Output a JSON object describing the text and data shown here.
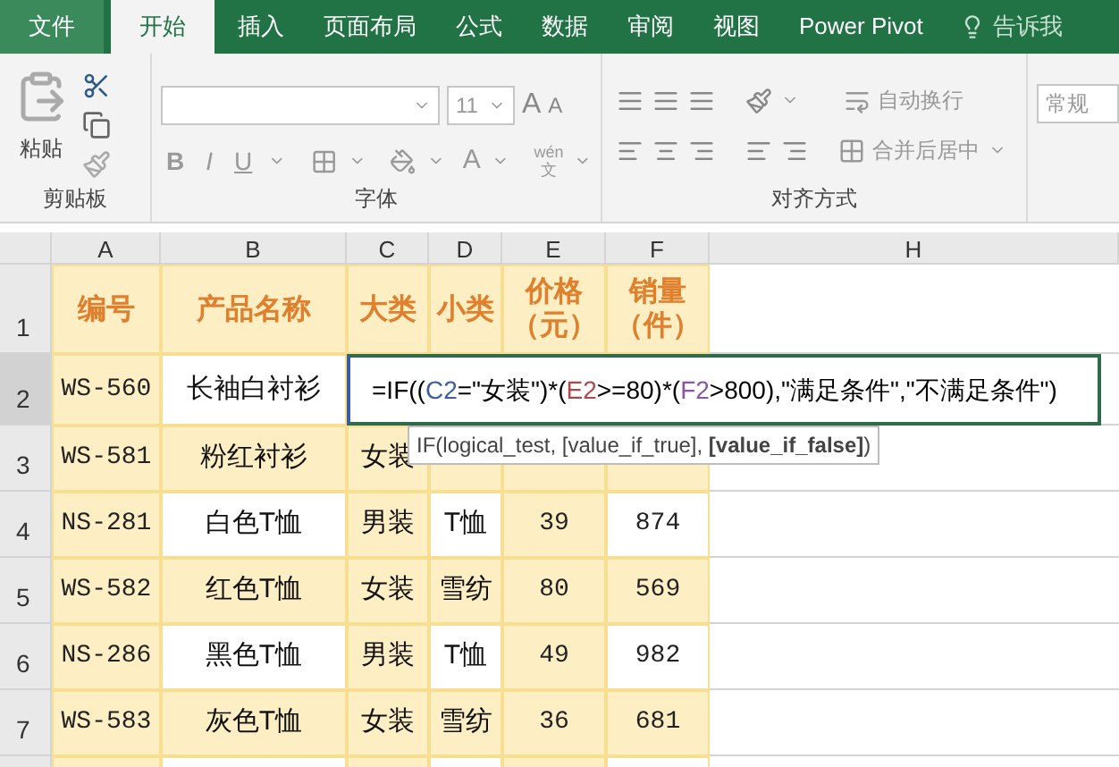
{
  "tabs": [
    {
      "label": "文件",
      "kind": "file",
      "selected": false
    },
    {
      "label": "开始",
      "kind": "tab",
      "selected": true
    },
    {
      "label": "插入",
      "kind": "tab",
      "selected": false
    },
    {
      "label": "页面布局",
      "kind": "tab",
      "selected": false
    },
    {
      "label": "公式",
      "kind": "tab",
      "selected": false
    },
    {
      "label": "数据",
      "kind": "tab",
      "selected": false
    },
    {
      "label": "审阅",
      "kind": "tab",
      "selected": false
    },
    {
      "label": "视图",
      "kind": "tab",
      "selected": false
    },
    {
      "label": "Power Pivot",
      "kind": "tab",
      "selected": false
    }
  ],
  "tell_me": "告诉我",
  "ribbon": {
    "clipboard": {
      "paste": "粘贴",
      "label": "剪贴板"
    },
    "font": {
      "size": "11",
      "grow": "A",
      "shrink": "A",
      "bold": "B",
      "italic": "I",
      "underline": "U",
      "font_color": "A",
      "phonetic_top": "wén",
      "phonetic_bottom": "文",
      "label": "字体"
    },
    "alignment": {
      "wrap": "自动换行",
      "merge": "合并后居中",
      "label": "对齐方式"
    },
    "number": {
      "format": "常规"
    }
  },
  "sheet": {
    "columns": [
      "A",
      "B",
      "C",
      "D",
      "E",
      "F",
      "H"
    ],
    "rows": [
      {
        "number": "1",
        "kind": "header",
        "cells": [
          "编号",
          "产品名称",
          "大类",
          "小类",
          "价格（元）",
          "销量（件）"
        ]
      },
      {
        "number": "2",
        "kind": "data",
        "striped": true,
        "active": true,
        "cells": [
          "WS-560",
          "长袖白衬衫"
        ]
      },
      {
        "number": "3",
        "kind": "data",
        "striped": false,
        "active": false,
        "cells": [
          "WS-581",
          "粉红衬衫",
          "女装"
        ]
      },
      {
        "number": "4",
        "kind": "data",
        "striped": true,
        "active": false,
        "cells": [
          "NS-281",
          "白色T恤",
          "男装",
          "T恤",
          "39",
          "874"
        ]
      },
      {
        "number": "5",
        "kind": "data",
        "striped": false,
        "active": false,
        "cells": [
          "WS-582",
          "红色T恤",
          "女装",
          "雪纺",
          "80",
          "569"
        ]
      },
      {
        "number": "6",
        "kind": "data",
        "striped": true,
        "active": false,
        "cells": [
          "NS-286",
          "黑色T恤",
          "男装",
          "T恤",
          "49",
          "982"
        ]
      },
      {
        "number": "7",
        "kind": "data",
        "striped": false,
        "active": false,
        "cells": [
          "WS-583",
          "灰色T恤",
          "女装",
          "雪纺",
          "36",
          "681"
        ]
      }
    ],
    "editing": {
      "formula": [
        {
          "text": "=IF((",
          "color": "#000000"
        },
        {
          "text": "C2",
          "color": "#3b5ba5"
        },
        {
          "text": "=\"女装\")*(",
          "color": "#000000"
        },
        {
          "text": "E2",
          "color": "#b0474a"
        },
        {
          "text": ">=80)*(",
          "color": "#000000"
        },
        {
          "text": "F2",
          "color": "#8a55a8"
        },
        {
          "text": ">800),\"满足条件\",\"不满足条件\")",
          "color": "#000000"
        }
      ]
    },
    "tooltip": "IF(logical_test, [value_if_true], **[value_if_false]**)"
  }
}
